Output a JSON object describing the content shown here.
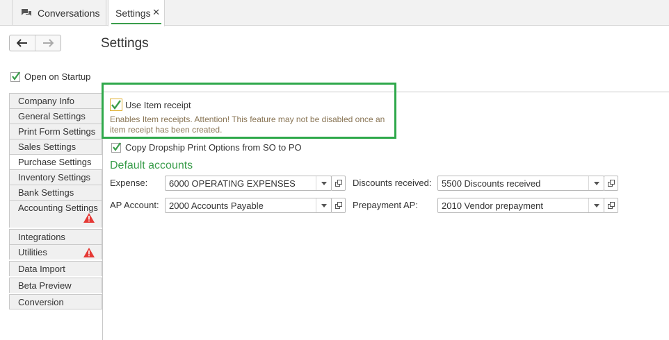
{
  "tabs": [
    {
      "label": "Conversations",
      "icon": "chat-bubbles-icon"
    },
    {
      "label": "Settings",
      "close": "✕"
    }
  ],
  "page": {
    "title": "Settings"
  },
  "open_on_startup": {
    "label": "Open on Startup",
    "checked": true
  },
  "sidebar": {
    "items": [
      {
        "label": "Company Info"
      },
      {
        "label": "General Settings"
      },
      {
        "label": "Print Form Settings"
      },
      {
        "label": "Sales Settings"
      },
      {
        "label": "Purchase Settings",
        "active": true
      },
      {
        "label": "Inventory Settings"
      },
      {
        "label": "Bank Settings"
      },
      {
        "label": "Accounting Settings",
        "warning": true
      },
      {
        "label": "Integrations"
      },
      {
        "label": "Utilities",
        "warning": true
      },
      {
        "label": "Data Import"
      },
      {
        "label": "Beta Preview"
      },
      {
        "label": "Conversion"
      }
    ]
  },
  "purchase": {
    "use_item_receipt": {
      "label": "Use Item receipt",
      "checked": true
    },
    "note": "Enables Item receipts.  Attention!  This feature may not be disabled once an item receipt has been created.",
    "copy_dropship": {
      "label": "Copy Dropship Print Options from SO to PO",
      "checked": true
    },
    "default_accounts_title": "Default accounts",
    "fields": {
      "expense": {
        "label": "Expense:",
        "value": "6000 OPERATING EXPENSES"
      },
      "discounts_received": {
        "label": "Discounts received:",
        "value": "5500 Discounts received"
      },
      "ap_account": {
        "label": "AP Account:",
        "value": "2000 Accounts Payable"
      },
      "prepayment_ap": {
        "label": "Prepayment AP:",
        "value": "2010 Vendor prepayment"
      }
    }
  },
  "colors": {
    "accent": "#3a9d4b",
    "highlight": "#2ea84a",
    "warning": "#e53935",
    "note_text": "#8a7656"
  }
}
